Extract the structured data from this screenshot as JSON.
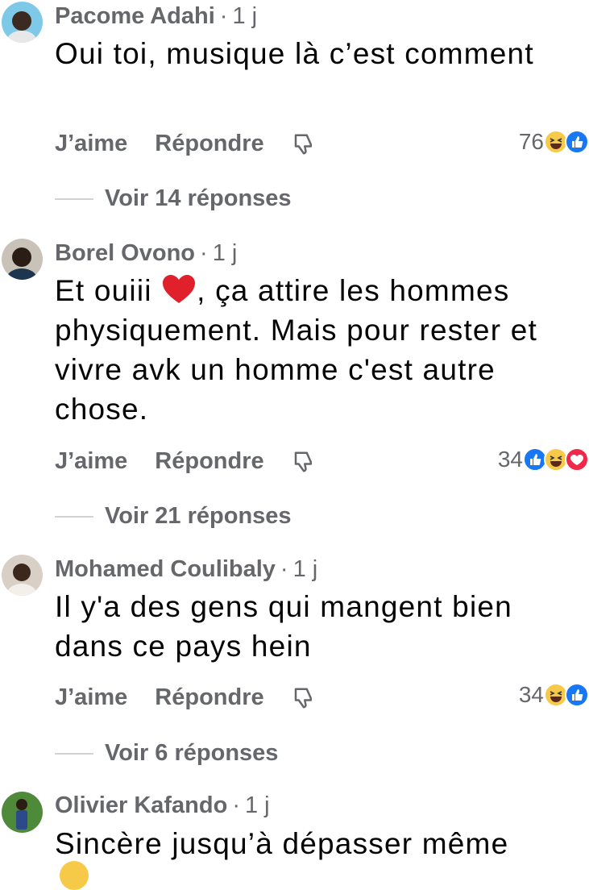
{
  "comments": [
    {
      "name": "Pacome Adahi",
      "time": "1 j",
      "text": "Oui toi, musique là c’est comment",
      "like_label": "J’aime",
      "reply_label": "Répondre",
      "reaction_count": "76",
      "reactions": [
        "haha-icon",
        "like-icon"
      ],
      "view_replies": "Voir 14 réponses"
    },
    {
      "name": "Borel Ovono",
      "time": "1 j",
      "text_before": "Et ouiii",
      "text_after": ", ça attire les hommes physiquement. Mais pour rester et vivre avk un homme c'est autre chose.",
      "like_label": "J’aime",
      "reply_label": "Répondre",
      "reaction_count": "34",
      "reactions": [
        "like-icon",
        "haha-icon",
        "love-icon"
      ],
      "view_replies": "Voir 21 réponses"
    },
    {
      "name": "Mohamed Coulibaly",
      "time": "1 j",
      "text": "Il y'a des gens qui mangent bien dans ce pays hein",
      "like_label": "J’aime",
      "reply_label": "Répondre",
      "reaction_count": "34",
      "reactions": [
        "haha-icon",
        "like-icon"
      ],
      "view_replies": "Voir 6 réponses"
    },
    {
      "name": "Olivier Kafando",
      "time": "1 j",
      "text": "Sincère jusqu’à dépasser même"
    }
  ],
  "colors": {
    "secondary_text": "#65676b",
    "primary_text": "#050505",
    "like_blue": "#1877f2",
    "haha_yellow": "#f7c948",
    "love_red": "#f02849"
  }
}
